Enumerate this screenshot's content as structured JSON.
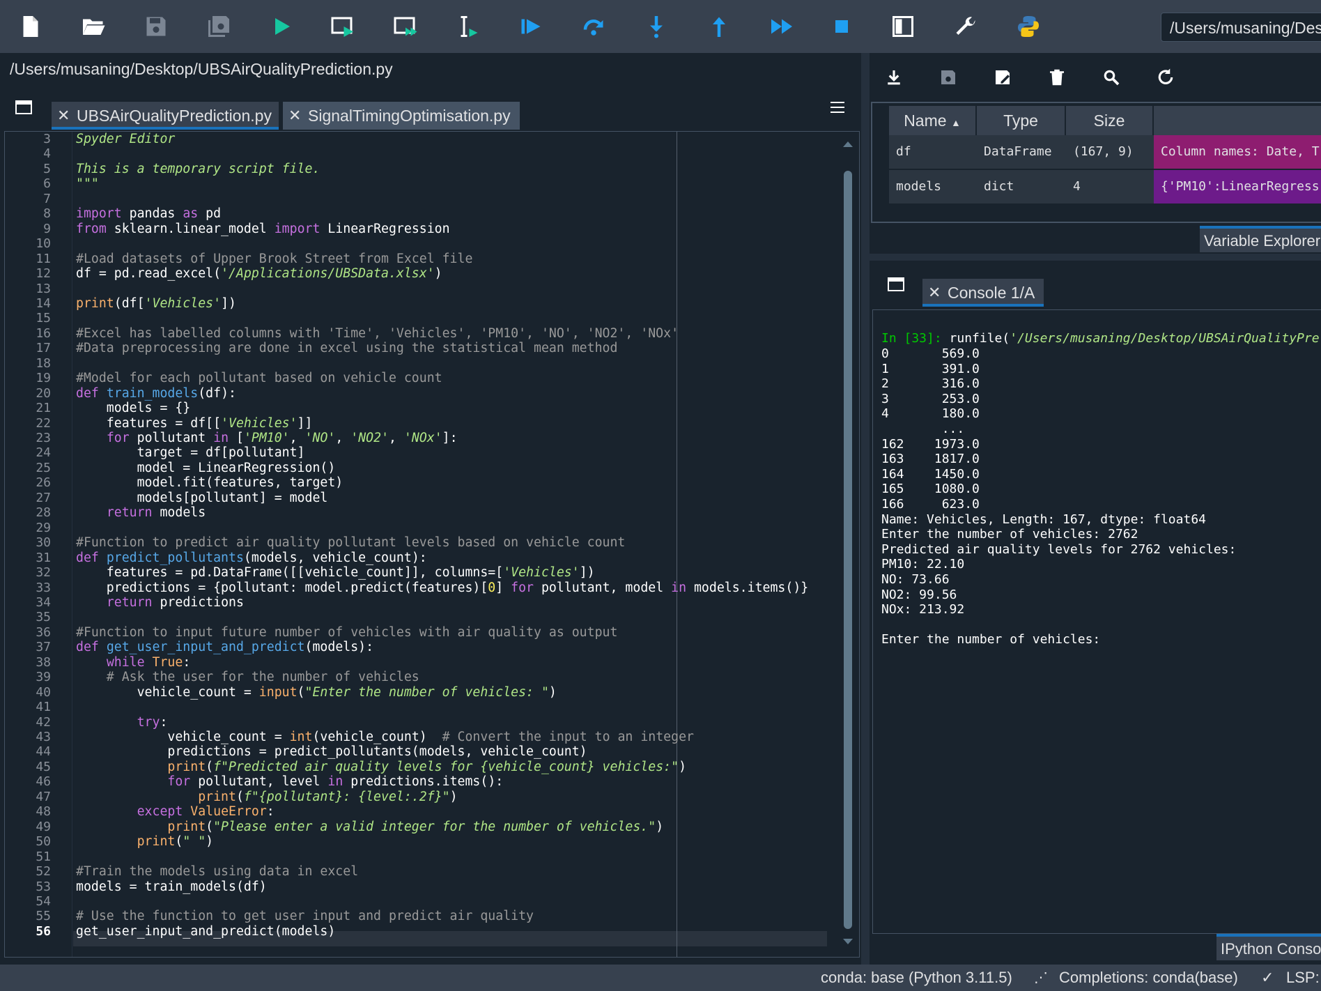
{
  "toolbar": {
    "buttons": [
      "new-file",
      "open-file",
      "save-file",
      "save-all",
      "run-file",
      "run-cell",
      "run-cell-advance",
      "run-selection",
      "debug-file",
      "step",
      "step-into",
      "step-return",
      "continue",
      "stop",
      "maximize-pane",
      "preferences",
      "python-path-manager"
    ],
    "working_directory": "/Users/musaning/Desktop"
  },
  "editor": {
    "file_path": "/Users/musaning/Desktop/UBSAirQualityPrediction.py",
    "tabs": [
      {
        "label": "UBSAirQualityPrediction.py",
        "active": true
      },
      {
        "label": "SignalTimingOptimisation.py",
        "active": false
      }
    ],
    "line_numbers": [
      "3",
      "4",
      "5",
      "6",
      "7",
      "8",
      "9",
      "10",
      "11",
      "12",
      "13",
      "14",
      "15",
      "16",
      "17",
      "18",
      "19",
      "20",
      "21",
      "22",
      "23",
      "24",
      "25",
      "26",
      "27",
      "28",
      "29",
      "30",
      "31",
      "32",
      "33",
      "34",
      "35",
      "36",
      "37",
      "38",
      "39",
      "40",
      "41",
      "42",
      "43",
      "44",
      "45",
      "46",
      "47",
      "48",
      "49",
      "50",
      "51",
      "52",
      "53",
      "54",
      "55",
      "56"
    ],
    "current_line": "56",
    "code_lines": [
      "Spyder Editor",
      "",
      "This is a temporary script file.",
      "\"\"\"",
      "",
      "import pandas as pd",
      "from sklearn.linear_model import LinearRegression",
      "",
      "#Load datasets of Upper Brook Street from Excel file",
      "df = pd.read_excel('/Applications/UBSData.xlsx')",
      "",
      "print(df['Vehicles'])",
      "",
      "#Excel has labelled columns with 'Time', 'Vehicles', 'PM10', 'NO', 'NO2', 'NOx'",
      "#Data preprocessing are done in excel using the statistical mean method",
      "",
      "#Model for each pollutant based on vehicle count",
      "def train_models(df):",
      "    models = {}",
      "    features = df[['Vehicles']]",
      "    for pollutant in ['PM10', 'NO', 'NO2', 'NOx']:",
      "        target = df[pollutant]",
      "        model = LinearRegression()",
      "        model.fit(features, target)",
      "        models[pollutant] = model",
      "    return models",
      "",
      "#Function to predict air quality pollutant levels based on vehicle count",
      "def predict_pollutants(models, vehicle_count):",
      "    features = pd.DataFrame([[vehicle_count]], columns=['Vehicles'])",
      "    predictions = {pollutant: model.predict(features)[0] for pollutant, model in models.items()}",
      "    return predictions",
      "",
      "#Function to input future number of vehicles with air quality as output",
      "def get_user_input_and_predict(models):",
      "    while True:",
      "    # Ask the user for the number of vehicles",
      "        vehicle_count = input(\"Enter the number of vehicles: \")",
      "",
      "        try:",
      "            vehicle_count = int(vehicle_count)  # Convert the input to an integer",
      "            predictions = predict_pollutants(models, vehicle_count)",
      "            print(f\"Predicted air quality levels for {vehicle_count} vehicles:\")",
      "            for pollutant, level in predictions.items():",
      "                print(f\"{pollutant}: {level:.2f}\")",
      "        except ValueError:",
      "            print(\"Please enter a valid integer for the number of vehicles.\")",
      "        print(\" \")",
      "",
      "#Train the models using data in excel",
      "models = train_models(df)",
      "",
      "# Use the function to get user input and predict air quality",
      "get_user_input_and_predict(models)"
    ]
  },
  "variable_explorer": {
    "tab_label": "Variable Explorer",
    "columns": [
      "Name",
      "Type",
      "Size"
    ],
    "rows": [
      {
        "name": "df",
        "type": "DataFrame",
        "size": "(167, 9)",
        "value": "Column names: Date, T",
        "color": "#8e1d70"
      },
      {
        "name": "models",
        "type": "dict",
        "size": "4",
        "value": "{'PM10':LinearRegress",
        "color": "#6d1b8a"
      }
    ]
  },
  "console": {
    "tab_label": "Console 1/A",
    "prompt": "In [33]:",
    "command": " runfile(",
    "command_arg": "'/Users/musaning/Desktop/UBSAirQualityPre",
    "output_lines": [
      "0       569.0",
      "1       391.0",
      "2       316.0",
      "3       253.0",
      "4       180.0",
      "        ...  ",
      "162    1973.0",
      "163    1817.0",
      "164    1450.0",
      "165    1080.0",
      "166     623.0",
      "Name: Vehicles, Length: 167, dtype: float64",
      "Enter the number of vehicles: 2762",
      "Predicted air quality levels for 2762 vehicles:",
      "PM10: 22.10",
      "NO: 73.66",
      "NO2: 99.56",
      "NOx: 213.92",
      "",
      "Enter the number of vehicles:"
    ],
    "bottom_tab_label": "IPython Conso"
  },
  "statusbar": {
    "env": "conda: base (Python 3.11.5)",
    "completions": "Completions: conda(base)",
    "lsp": "LSP:"
  },
  "colors": {
    "background": "#19232d",
    "toolbar": "#37414f",
    "accent": "#1a72bb",
    "run_icon": "#16c7a0",
    "debug_icon": "#1f9ff2"
  }
}
